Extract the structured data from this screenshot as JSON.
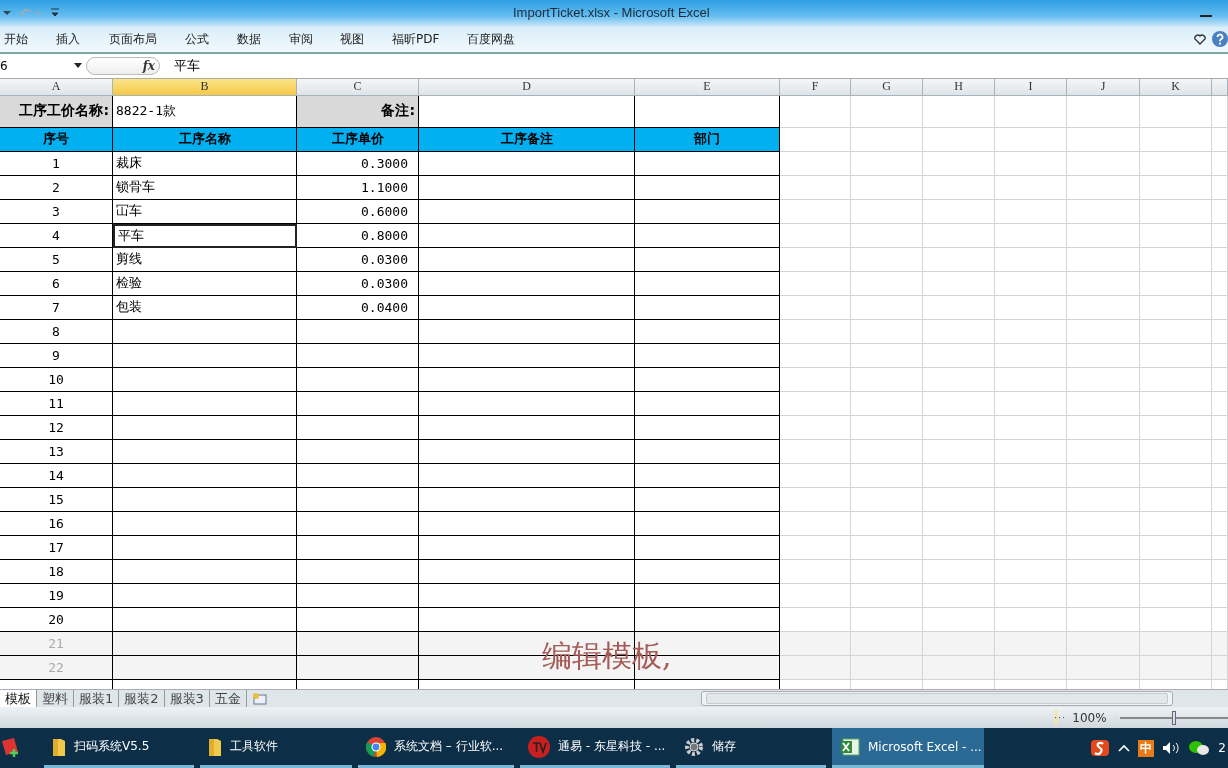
{
  "window": {
    "title": "ImportTicket.xlsx - Microsoft Excel"
  },
  "ribbon_tabs": [
    "开始",
    "插入",
    "页面布局",
    "公式",
    "数据",
    "审阅",
    "视图",
    "福昕PDF",
    "百度网盘"
  ],
  "formula_bar": {
    "name_box": "6",
    "fx": "fx",
    "formula": "平车"
  },
  "columns": [
    {
      "label": "A",
      "selected": false
    },
    {
      "label": "B",
      "selected": true
    },
    {
      "label": "C",
      "selected": false
    },
    {
      "label": "D",
      "selected": false
    },
    {
      "label": "E",
      "selected": false
    },
    {
      "label": "F",
      "selected": false
    },
    {
      "label": "G",
      "selected": false
    },
    {
      "label": "H",
      "selected": false
    },
    {
      "label": "I",
      "selected": false
    },
    {
      "label": "J",
      "selected": false
    },
    {
      "label": "K",
      "selected": false
    }
  ],
  "info_row": {
    "label": "工序工价名称:",
    "value": "8822-1款",
    "note_label": "备注:"
  },
  "table": {
    "columns": [
      "序号",
      "工序名称",
      "工序单价",
      "工序备注",
      "部门"
    ],
    "rows": [
      {
        "no": "1",
        "name": "裁床",
        "price": "0.3000",
        "selected": false
      },
      {
        "no": "2",
        "name": "锁骨车",
        "price": "1.1000",
        "selected": false
      },
      {
        "no": "3",
        "name": "冚车",
        "price": "0.6000",
        "selected": false
      },
      {
        "no": "4",
        "name": "平车",
        "price": "0.8000",
        "selected": true
      },
      {
        "no": "5",
        "name": "剪线",
        "price": "0.0300",
        "selected": false
      },
      {
        "no": "6",
        "name": "检验",
        "price": "0.0300",
        "selected": false
      },
      {
        "no": "7",
        "name": "包装",
        "price": "0.0400",
        "selected": false
      },
      {
        "no": "8",
        "selected": false
      },
      {
        "no": "9",
        "selected": false
      },
      {
        "no": "10",
        "selected": false
      },
      {
        "no": "11",
        "selected": false
      },
      {
        "no": "12",
        "selected": false
      },
      {
        "no": "13",
        "selected": false
      },
      {
        "no": "14",
        "selected": false
      },
      {
        "no": "15",
        "selected": false
      },
      {
        "no": "16",
        "selected": false
      },
      {
        "no": "17",
        "selected": false
      },
      {
        "no": "18",
        "selected": false
      },
      {
        "no": "19",
        "selected": false
      },
      {
        "no": "20",
        "selected": false
      },
      {
        "no": "21",
        "selected": false
      },
      {
        "no": "22",
        "selected": false
      }
    ]
  },
  "caption": "编辑模板,",
  "sheet_tabs": [
    {
      "label": "模板",
      "selected": true
    },
    {
      "label": "塑料",
      "selected": false
    },
    {
      "label": "服装1",
      "selected": false
    },
    {
      "label": "服装2",
      "selected": false
    },
    {
      "label": "服装3",
      "selected": false
    },
    {
      "label": "五金",
      "selected": false
    }
  ],
  "status_bar": {
    "zoom": "100%",
    "zoom_slider": {
      "level": 0.5
    }
  },
  "taskbar": {
    "items": [
      {
        "kind": "folder",
        "label": "扫码系统V5.5",
        "selected": false
      },
      {
        "kind": "folder",
        "label": "工具软件",
        "selected": false
      },
      {
        "kind": "browser",
        "label": "系统文档 – 行业软...",
        "selected": false
      },
      {
        "kind": "tv",
        "label": "通易 - 东星科技 - ...",
        "selected": false
      },
      {
        "kind": "gear",
        "label": "储存",
        "selected": false
      },
      {
        "kind": "excel",
        "label": "Microsoft Excel - ...",
        "selected": true
      }
    ],
    "ime": "中",
    "clock": "2"
  }
}
